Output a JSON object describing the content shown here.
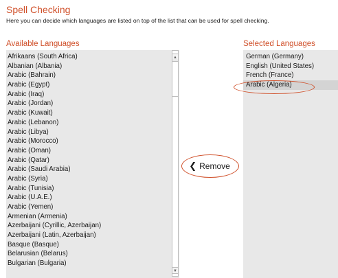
{
  "section": {
    "title": "Spell Checking",
    "description": "Here you can decide which languages are listed on top of the list that can be used for spell checking."
  },
  "available": {
    "header": "Available Languages",
    "items": [
      "Afrikaans (South Africa)",
      "Albanian (Albania)",
      "Arabic (Bahrain)",
      "Arabic (Egypt)",
      "Arabic (Iraq)",
      "Arabic (Jordan)",
      "Arabic (Kuwait)",
      "Arabic (Lebanon)",
      "Arabic (Libya)",
      "Arabic (Morocco)",
      "Arabic (Oman)",
      "Arabic (Qatar)",
      "Arabic (Saudi Arabia)",
      "Arabic (Syria)",
      "Arabic (Tunisia)",
      "Arabic (U.A.E.)",
      "Arabic (Yemen)",
      "Armenian (Armenia)",
      "Azerbaijani (Cyrillic, Azerbaijan)",
      "Azerbaijani (Latin, Azerbaijan)",
      "Basque (Basque)",
      "Belarusian (Belarus)",
      "Bulgarian (Bulgaria)"
    ]
  },
  "scrollbar": {
    "up_icon": "▲",
    "down_icon": "▼"
  },
  "remove_button": {
    "icon": "chevron-left-icon",
    "chevron_glyph": "❮",
    "label": "Remove"
  },
  "selected": {
    "header": "Selected Languages",
    "items": [
      "German (Germany)",
      "English (United States)",
      "French (France)",
      "Arabic (Algeria)"
    ],
    "selected_item": "Arabic (Algeria)"
  },
  "colors": {
    "accent": "#d0502a",
    "list_background": "#e8e8e8",
    "selected_row": "#d4d4d4"
  }
}
